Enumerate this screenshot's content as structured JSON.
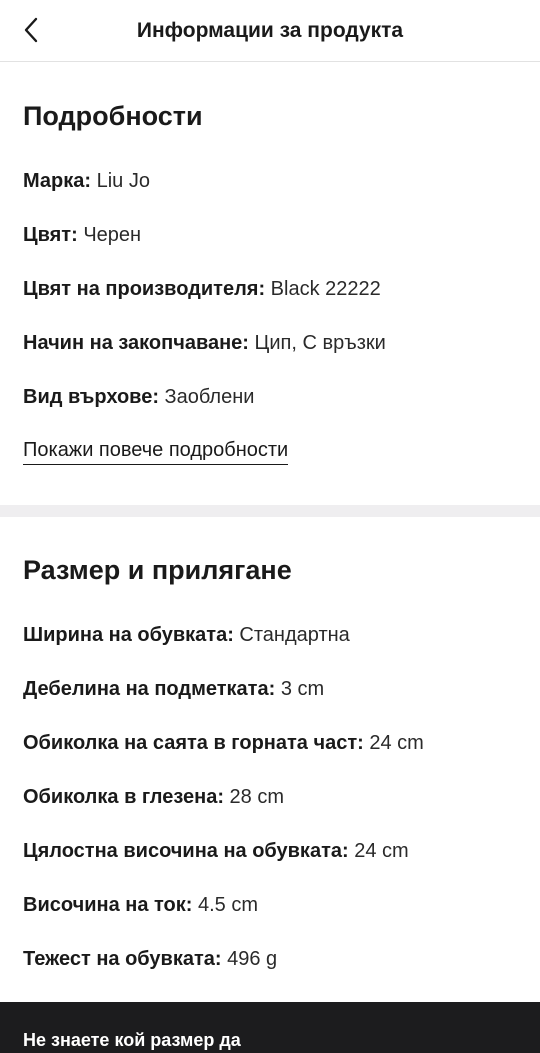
{
  "header": {
    "title": "Информации за продукта",
    "back_icon": "chevron-left-icon"
  },
  "details": {
    "title": "Подробности",
    "rows": [
      {
        "label": "Марка:",
        "value": "Liu Jo"
      },
      {
        "label": "Цвят:",
        "value": "Черен"
      },
      {
        "label": "Цвят на производителя:",
        "value": "Black 22222"
      },
      {
        "label": "Начин на закопчаване:",
        "value": "Цип, С връзки"
      },
      {
        "label": "Вид върхове:",
        "value": "Заоблени"
      }
    ],
    "more_link": "Покажи повече подробности"
  },
  "size_fit": {
    "title": "Размер и прилягане",
    "rows": [
      {
        "label": "Ширина на обувката:",
        "value": "Стандартна"
      },
      {
        "label": "Дебелина на подметката:",
        "value": "3 cm"
      },
      {
        "label": "Обиколка на саята в горната част:",
        "value": "24 cm"
      },
      {
        "label": "Обиколка в глезена:",
        "value": "28 cm"
      },
      {
        "label": "Цялостна височина на обувката:",
        "value": "24 cm"
      },
      {
        "label": "Височина на ток:",
        "value": "4.5 cm"
      },
      {
        "label": "Тежест на обувката:",
        "value": "496 g"
      }
    ]
  },
  "footer": {
    "text": "Не знаете кой размер да"
  },
  "colors": {
    "text": "#1a1a1a",
    "divider": "#efeef0",
    "footer_bg": "#1c1c1e",
    "footer_text": "#ffffff"
  }
}
